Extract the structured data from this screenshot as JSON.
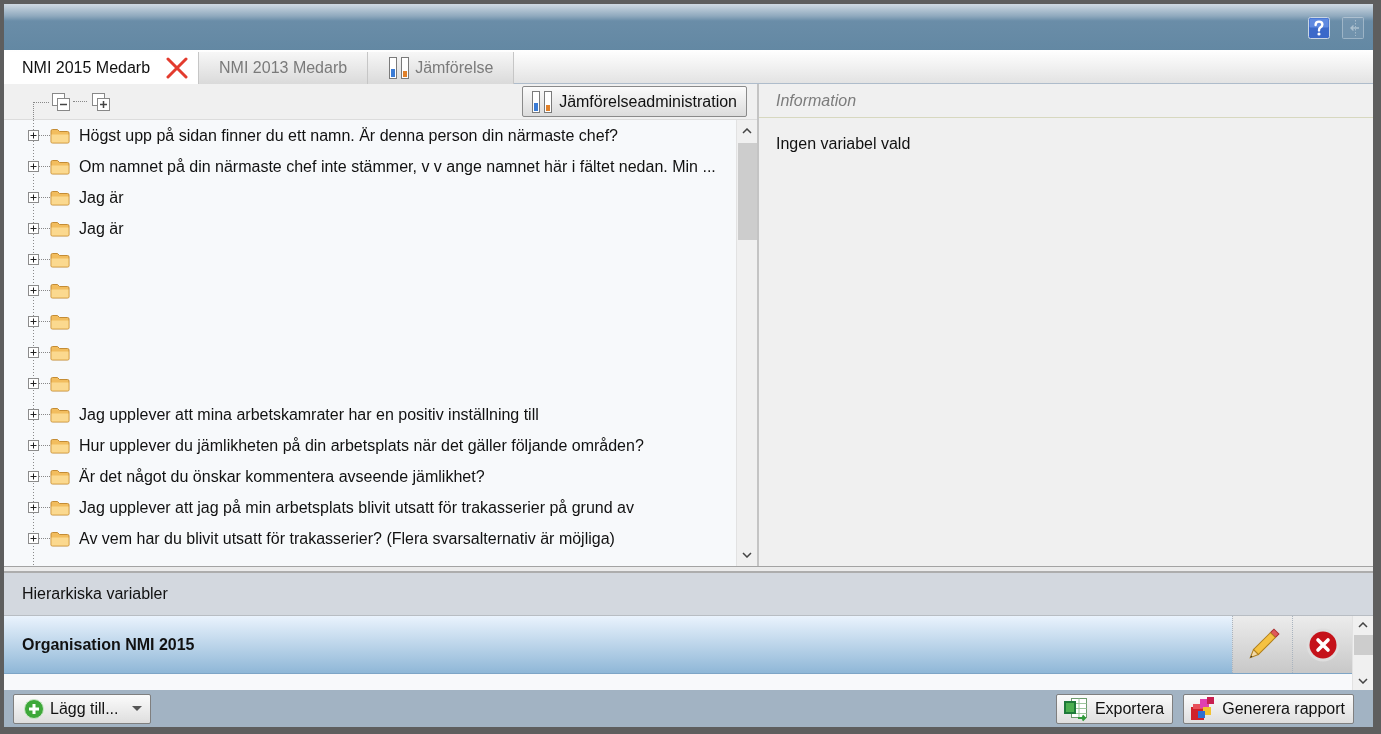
{
  "title_bar": {
    "buttons": [
      {
        "kind": "help",
        "disabled": false
      },
      {
        "kind": "exit",
        "disabled": true
      }
    ]
  },
  "tabs": [
    {
      "label": "NMI 2015 Medarb",
      "selected": true,
      "kind": "survey"
    },
    {
      "label": "NMI 2013 Medarb",
      "selected": false,
      "kind": "survey"
    },
    {
      "label": "Jämförelse",
      "selected": false,
      "kind": "comparison"
    }
  ],
  "tree_panel": {
    "toolbar_button": "Jämförelseadministration",
    "items": [
      {
        "label": "Högst upp på sidan finner du ett namn. Är denna person din närmaste chef?",
        "expanded": false
      },
      {
        "label": "Om namnet på din närmaste chef inte stämmer, v v ange namnet här i fältet nedan. Min ...",
        "expanded": false
      },
      {
        "label": "Jag är",
        "expanded": false
      },
      {
        "label": "Jag är",
        "expanded": false
      },
      {
        "expanded": false
      },
      {
        "expanded": false
      },
      {
        "expanded": false
      },
      {
        "expanded": false
      },
      {
        "expanded": false
      },
      {
        "label": "Jag upplever att mina arbetskamrater har en positiv inställning till",
        "expanded": false
      },
      {
        "label": "Hur upplever du jämlikheten på din arbetsplats när det gäller följande områden?",
        "expanded": false
      },
      {
        "label": "Är det något du önskar kommentera avseende jämlikhet?",
        "expanded": false
      },
      {
        "label": "Jag upplever att jag på min arbetsplats blivit utsatt för trakasserier på grund av",
        "expanded": false
      },
      {
        "label": "Av vem har du blivit utsatt för trakasserier? (Flera svarsalternativ är möjliga)",
        "expanded": false
      }
    ]
  },
  "info_panel": {
    "title": "Information",
    "message": "Ingen variabel vald"
  },
  "hierarchy_panel": {
    "title": "Hierarkiska variabler",
    "rows": [
      {
        "label": "Organisation NMI 2015",
        "selected": true
      }
    ]
  },
  "footer": {
    "add_button": "Lägg till...",
    "buttons": [
      {
        "label": "Exportera",
        "kind": "export"
      },
      {
        "label": "Generera rapport",
        "kind": "report"
      }
    ]
  }
}
